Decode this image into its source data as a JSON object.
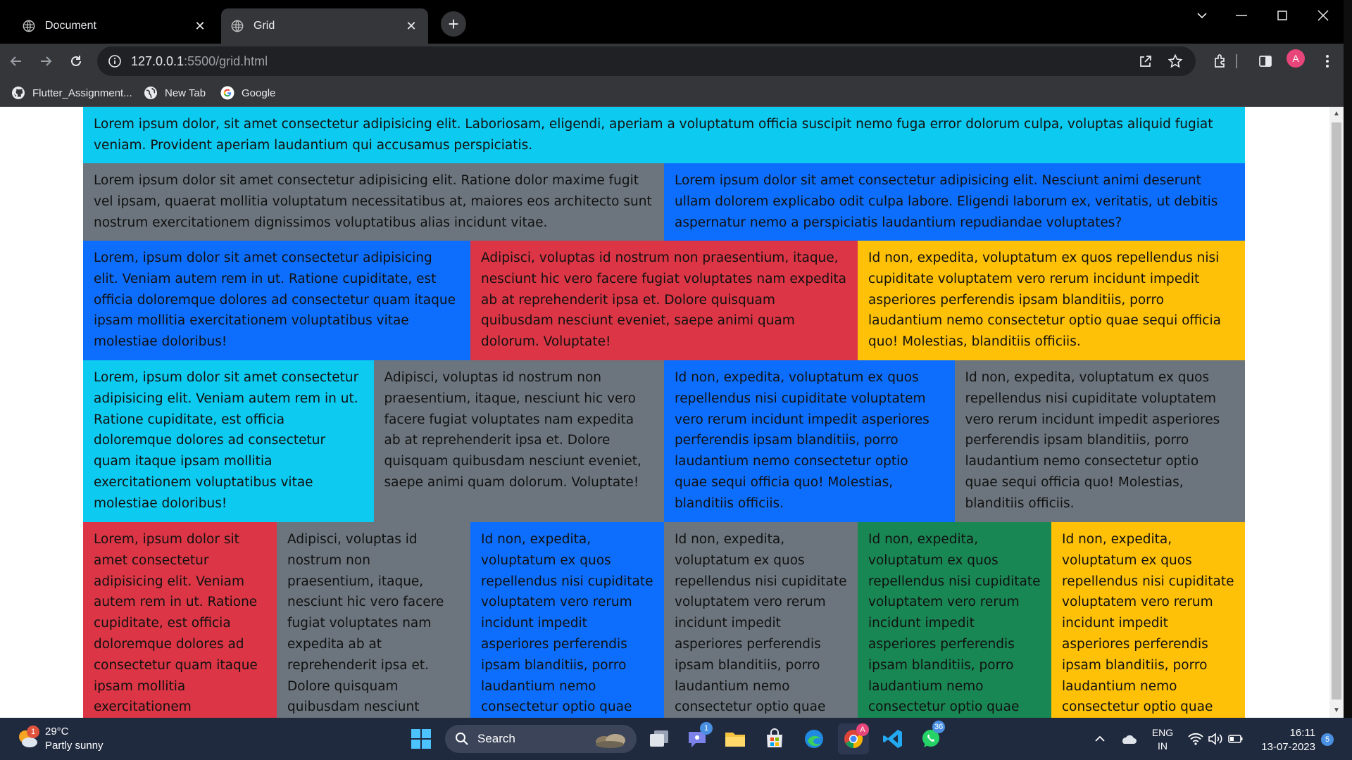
{
  "tabs": [
    {
      "title": "Document"
    },
    {
      "title": "Grid"
    }
  ],
  "address": {
    "host": "127.0.0.1",
    "path": ":5500/grid.html"
  },
  "profile_initial": "A",
  "bookmarks": [
    {
      "label": "Flutter_Assignment...",
      "icon": "github-icon"
    },
    {
      "label": "New Tab",
      "icon": "globe-icon"
    },
    {
      "label": "Google",
      "icon": "google-icon"
    }
  ],
  "colors": {
    "cyan": "#0dcaf0",
    "gray": "#6c757d",
    "blue": "#0d6efd",
    "red": "#dc3545",
    "yellow": "#ffc107",
    "green": "#198754"
  },
  "rows": [
    [
      {
        "text": "Lorem ipsum dolor, sit amet consectetur adipisicing elit. Laboriosam, eligendi, aperiam a voluptatum officia suscipit nemo fuga error dolorum culpa, voluptas aliquid fugiat veniam. Provident aperiam laudantium qui accusamus perspiciatis.",
        "color": "cyan"
      }
    ],
    [
      {
        "text": "Lorem ipsum dolor sit amet consectetur adipisicing elit. Ratione dolor maxime fugit vel ipsam, quaerat mollitia voluptatum necessitatibus at, maiores eos architecto sunt nostrum exercitationem dignissimos voluptatibus alias incidunt vitae.",
        "color": "gray"
      },
      {
        "text": "Lorem ipsum dolor sit amet consectetur adipisicing elit. Nesciunt animi deserunt ullam dolorem explicabo odit culpa labore. Eligendi laborum ex, veritatis, ut debitis aspernatur nemo a perspiciatis laudantium repudiandae voluptates?",
        "color": "blue"
      }
    ],
    [
      {
        "text": "Lorem, ipsum dolor sit amet consectetur adipisicing elit. Veniam autem rem in ut. Ratione cupiditate, est officia doloremque dolores ad consectetur quam itaque ipsam mollitia exercitationem voluptatibus vitae molestiae doloribus!",
        "color": "blue"
      },
      {
        "text": "Adipisci, voluptas id nostrum non praesentium, itaque, nesciunt hic vero facere fugiat voluptates nam expedita ab at reprehenderit ipsa et. Dolore quisquam quibusdam nesciunt eveniet, saepe animi quam dolorum. Voluptate!",
        "color": "red"
      },
      {
        "text": "Id non, expedita, voluptatum ex quos repellendus nisi cupiditate voluptatem vero rerum incidunt impedit asperiores perferendis ipsam blanditiis, porro laudantium nemo consectetur optio quae sequi officia quo! Molestias, blanditiis officiis.",
        "color": "yellow"
      }
    ],
    [
      {
        "text": "Lorem, ipsum dolor sit amet consectetur adipisicing elit. Veniam autem rem in ut. Ratione cupiditate, est officia doloremque dolores ad consectetur quam itaque ipsam mollitia exercitationem voluptatibus vitae molestiae doloribus!",
        "color": "cyan"
      },
      {
        "text": "Adipisci, voluptas id nostrum non praesentium, itaque, nesciunt hic vero facere fugiat voluptates nam expedita ab at reprehenderit ipsa et. Dolore quisquam quibusdam nesciunt eveniet, saepe animi quam dolorum. Voluptate!",
        "color": "gray"
      },
      {
        "text": "Id non, expedita, voluptatum ex quos repellendus nisi cupiditate voluptatem vero rerum incidunt impedit asperiores perferendis ipsam blanditiis, porro laudantium nemo consectetur optio quae sequi officia quo! Molestias, blanditiis officiis.",
        "color": "blue"
      },
      {
        "text": "Id non, expedita, voluptatum ex quos repellendus nisi cupiditate voluptatem vero rerum incidunt impedit asperiores perferendis ipsam blanditiis, porro laudantium nemo consectetur optio quae sequi officia quo! Molestias, blanditiis officiis.",
        "color": "gray"
      }
    ],
    [
      {
        "text": "Lorem, ipsum dolor sit amet consectetur adipisicing elit. Veniam autem rem in ut. Ratione cupiditate, est officia doloremque dolores ad consectetur quam itaque ipsam mollitia exercitationem",
        "color": "red"
      },
      {
        "text": "Adipisci, voluptas id nostrum non praesentium, itaque, nesciunt hic vero facere fugiat voluptates nam expedita ab at reprehenderit ipsa et. Dolore quisquam quibusdam nesciunt eveniet, saepe animi quam",
        "color": "gray"
      },
      {
        "text": "Id non, expedita, voluptatum ex quos repellendus nisi cupiditate voluptatem vero rerum incidunt impedit asperiores perferendis ipsam blanditiis, porro laudantium nemo consectetur optio quae sequi officia quo!",
        "color": "blue"
      },
      {
        "text": "Id non, expedita, voluptatum ex quos repellendus nisi cupiditate voluptatem vero rerum incidunt impedit asperiores perferendis ipsam blanditiis, porro laudantium nemo consectetur optio quae sequi officia quo!",
        "color": "gray"
      },
      {
        "text": "Id non, expedita, voluptatum ex quos repellendus nisi cupiditate voluptatem vero rerum incidunt impedit asperiores perferendis ipsam blanditiis, porro laudantium nemo consectetur optio quae sequi officia quo!",
        "color": "green"
      },
      {
        "text": "Id non, expedita, voluptatum ex quos repellendus nisi cupiditate voluptatem vero rerum incidunt impedit asperiores perferendis ipsam blanditiis, porro laudantium nemo consectetur optio quae sequi officia quo!",
        "color": "yellow"
      }
    ]
  ],
  "taskbar": {
    "weather": {
      "temp": "29°C",
      "condition": "Partly sunny",
      "badge": "1"
    },
    "search_label": "Search",
    "teams_badge": "1",
    "whatsapp_badge": "36",
    "lang": {
      "line1": "ENG",
      "line2": "IN"
    },
    "time": "16:11",
    "date": "13-07-2023",
    "notification_count": "5"
  }
}
